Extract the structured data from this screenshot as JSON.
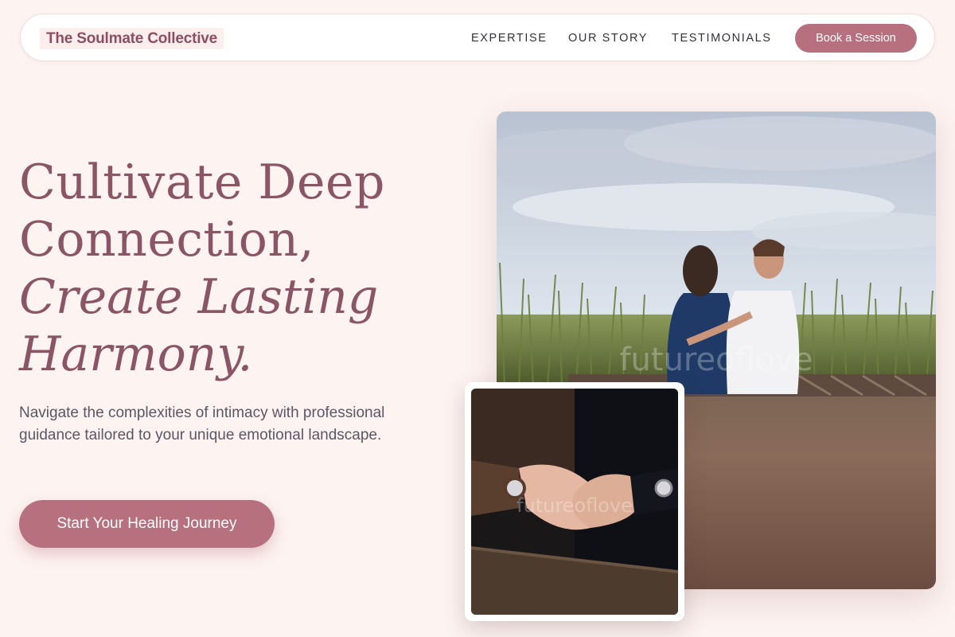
{
  "nav": {
    "brand": "The Soulmate Collective",
    "links": [
      "EXPERTISE",
      "OUR STORY",
      "TESTIMONIALS"
    ],
    "cta": "Book a Session"
  },
  "hero": {
    "title_line1": "Cultivate Deep",
    "title_line2": "Connection,",
    "title_line3": "Create Lasting",
    "title_line4": "Harmony.",
    "subtitle": "Navigate the complexities of intimacy with professional guidance tailored to your unique emotional landscape.",
    "cta": "Start Your Healing Journey"
  },
  "images": {
    "main_watermark": "futureoflove",
    "inset_watermark": "futureoflove"
  },
  "colors": {
    "background": "#fdf3f1",
    "accent": "#b7707d",
    "brand_text": "#8c4e62",
    "heading": "#8a5666"
  }
}
